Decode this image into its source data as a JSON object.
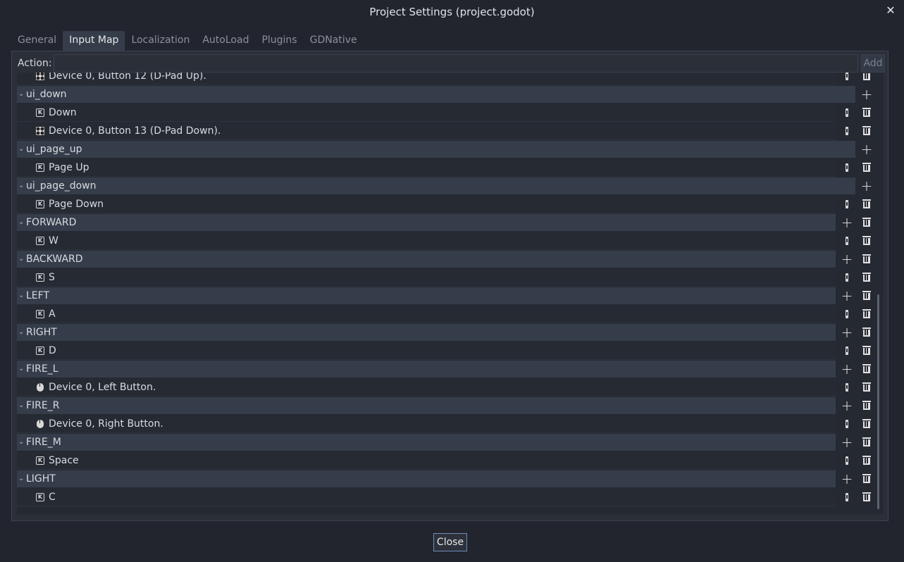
{
  "window": {
    "title": "Project Settings (project.godot)",
    "close_icon": "✕"
  },
  "tabs": [
    {
      "label": "General",
      "active": false
    },
    {
      "label": "Input Map",
      "active": true
    },
    {
      "label": "Localization",
      "active": false
    },
    {
      "label": "AutoLoad",
      "active": false
    },
    {
      "label": "Plugins",
      "active": false
    },
    {
      "label": "GDNative",
      "active": false
    }
  ],
  "action_bar": {
    "label": "Action:",
    "value": "",
    "add_label": "Add"
  },
  "rows": [
    {
      "type": "event",
      "icon": "joypad",
      "text": "Device 0, Button 12 (D-Pad Up)."
    },
    {
      "type": "action",
      "text": "ui_down",
      "builtin": true
    },
    {
      "type": "event",
      "icon": "key",
      "text": "Down"
    },
    {
      "type": "event",
      "icon": "joypad",
      "text": "Device 0, Button 13 (D-Pad Down)."
    },
    {
      "type": "action",
      "text": "ui_page_up",
      "builtin": true
    },
    {
      "type": "event",
      "icon": "key",
      "text": "Page Up"
    },
    {
      "type": "action",
      "text": "ui_page_down",
      "builtin": true
    },
    {
      "type": "event",
      "icon": "key",
      "text": "Page Down"
    },
    {
      "type": "action",
      "text": "FORWARD",
      "builtin": false
    },
    {
      "type": "event",
      "icon": "key",
      "text": "W"
    },
    {
      "type": "action",
      "text": "BACKWARD",
      "builtin": false
    },
    {
      "type": "event",
      "icon": "key",
      "text": "S"
    },
    {
      "type": "action",
      "text": "LEFT",
      "builtin": false
    },
    {
      "type": "event",
      "icon": "key",
      "text": "A"
    },
    {
      "type": "action",
      "text": "RIGHT",
      "builtin": false
    },
    {
      "type": "event",
      "icon": "key",
      "text": "D"
    },
    {
      "type": "action",
      "text": "FIRE_L",
      "builtin": false
    },
    {
      "type": "event",
      "icon": "mouse",
      "text": "Device 0, Left Button."
    },
    {
      "type": "action",
      "text": "FIRE_R",
      "builtin": false
    },
    {
      "type": "event",
      "icon": "mouse",
      "text": "Device 0, Right Button."
    },
    {
      "type": "action",
      "text": "FIRE_M",
      "builtin": false
    },
    {
      "type": "event",
      "icon": "key",
      "text": "Space"
    },
    {
      "type": "action",
      "text": "LIGHT",
      "builtin": false
    },
    {
      "type": "event",
      "icon": "key",
      "text": "C"
    }
  ],
  "footer": {
    "close_label": "Close"
  }
}
